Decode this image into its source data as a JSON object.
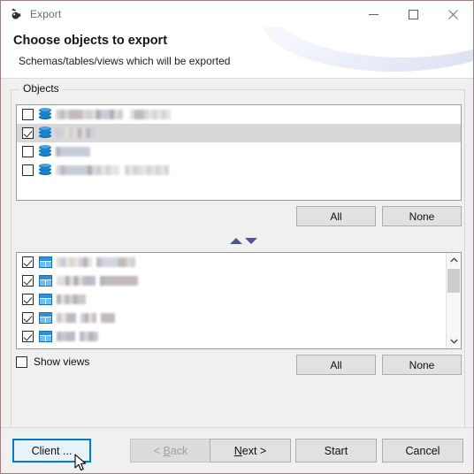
{
  "window": {
    "title": "Export",
    "icon": "app-icon",
    "border_color": "#9e7d7d",
    "controls": [
      {
        "name": "minimize",
        "glyph": "minimize-icon"
      },
      {
        "name": "maximize",
        "glyph": "maximize-icon"
      },
      {
        "name": "close",
        "glyph": "close-icon"
      }
    ]
  },
  "header": {
    "title": "Choose objects to export",
    "subtitle": "Schemas/tables/views which will be exported",
    "accent_color": "#ccd6ee"
  },
  "objects": {
    "legend": "Objects",
    "schema_list": {
      "name": "schema-list",
      "icon": "database-icon",
      "rows": [
        {
          "checked": false,
          "selected": false,
          "label": "",
          "blur_width": 122,
          "blur_segments": [
            {
              "w": 76,
              "gap": 8
            },
            {
              "w": 46,
              "gap": 0
            }
          ]
        },
        {
          "checked": true,
          "selected": true,
          "label": "",
          "blur_width": 44,
          "blur_segments": [
            {
              "w": 44,
              "gap": 0
            }
          ]
        },
        {
          "checked": false,
          "selected": false,
          "label": "",
          "blur_width": 39,
          "blur_segments": [
            {
              "w": 39,
              "gap": 0
            }
          ]
        },
        {
          "checked": false,
          "selected": false,
          "label": "",
          "blur_width": 128,
          "blur_segments": [
            {
              "w": 72,
              "gap": 6
            },
            {
              "w": 50,
              "gap": 0
            }
          ]
        }
      ]
    },
    "table_list": {
      "name": "table-list",
      "icon": "table-icon",
      "rows": [
        {
          "checked": true,
          "blur_segments": [
            {
              "w": 40,
              "gap": 5
            },
            {
              "w": 44,
              "gap": 0
            }
          ]
        },
        {
          "checked": true,
          "blur_segments": [
            {
              "w": 44,
              "gap": 5
            },
            {
              "w": 43,
              "gap": 0
            }
          ]
        },
        {
          "checked": true,
          "blur_segments": [
            {
              "w": 33,
              "gap": 0
            }
          ]
        },
        {
          "checked": true,
          "blur_segments": [
            {
              "w": 22,
              "gap": 5
            },
            {
              "w": 18,
              "gap": 5
            },
            {
              "w": 16,
              "gap": 0
            }
          ]
        },
        {
          "checked": true,
          "blur_segments": [
            {
              "w": 21,
              "gap": 5
            },
            {
              "w": 21,
              "gap": 0
            }
          ]
        },
        {
          "checked": true,
          "blur_segments": [
            {
              "w": 20,
              "gap": 0
            }
          ]
        }
      ],
      "scrollbar": {
        "up": "chevron-up-icon",
        "down": "chevron-down-icon",
        "thumb_position": "top"
      }
    },
    "move_up_label": "▲",
    "move_down_label": "▼",
    "all_label": "All",
    "none_label": "None",
    "show_views": {
      "label": "Show views",
      "checked": false
    }
  },
  "footer": {
    "client_label": "Client ...",
    "back_label_prefix": "< ",
    "back_label_accel": "B",
    "back_label_rest": "ack",
    "back_disabled": true,
    "next_label_accel": "N",
    "next_label_rest": "ext >",
    "start_label": "Start",
    "cancel_label": "Cancel",
    "focus_color": "#0078d7"
  }
}
